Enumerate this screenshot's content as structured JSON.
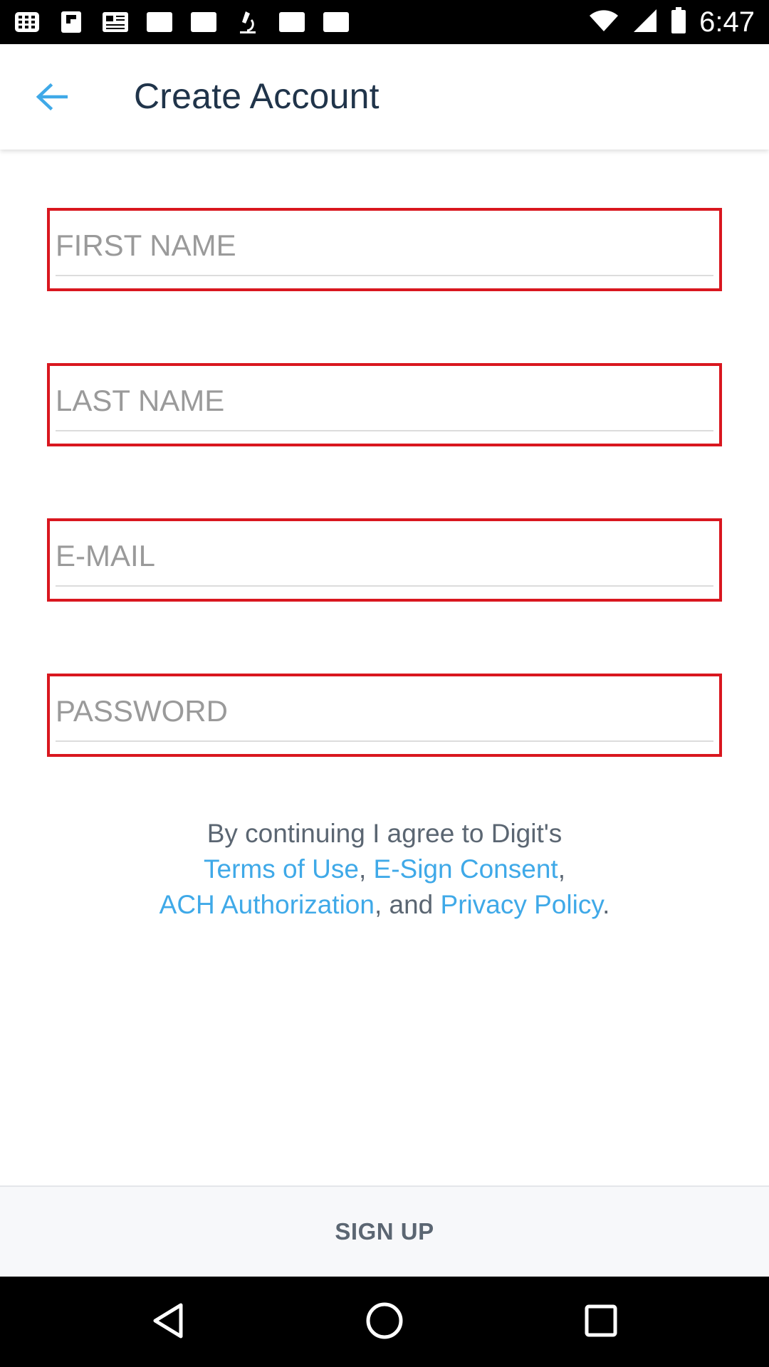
{
  "status_bar": {
    "time": "6:47",
    "icons": [
      "app-grid-icon",
      "flipboard-icon",
      "news-icon",
      "gallery-icon",
      "gallery-icon",
      "microscope-icon",
      "gallery-icon",
      "gallery-icon",
      "wifi-icon",
      "signal-icon",
      "battery-icon"
    ]
  },
  "header": {
    "title": "Create Account",
    "back_icon": "arrow-back-icon"
  },
  "form": {
    "first_name": {
      "placeholder": "FIRST NAME",
      "value": ""
    },
    "last_name": {
      "placeholder": "LAST NAME",
      "value": ""
    },
    "email": {
      "placeholder": "E-MAIL",
      "value": ""
    },
    "password": {
      "placeholder": "PASSWORD",
      "value": ""
    }
  },
  "agreement": {
    "prefix": "By continuing I agree to Digit's",
    "terms": "Terms of Use",
    "sep1": ", ",
    "esign": "E-Sign Consent",
    "sep2": ",",
    "ach": "ACH Authorization",
    "sep3": ", and ",
    "privacy": "Privacy Policy",
    "end": "."
  },
  "signup": {
    "label": "SIGN UP"
  },
  "colors": {
    "field_border": "#d9171f",
    "link": "#3fa9e8",
    "title": "#20344a",
    "back_arrow": "#3fa9e8"
  },
  "nav_bar": {
    "icons": [
      "back-triangle-icon",
      "home-circle-icon",
      "recents-square-icon"
    ]
  }
}
